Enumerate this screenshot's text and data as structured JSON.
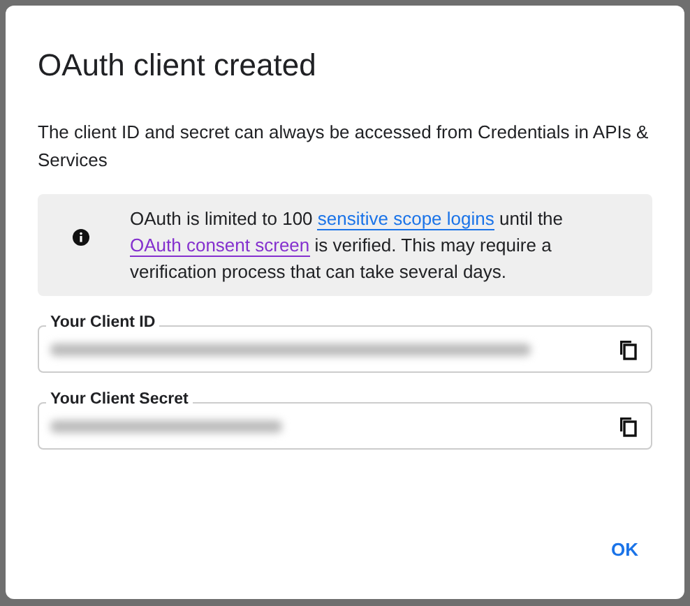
{
  "dialog": {
    "title": "OAuth client created",
    "description": "The client ID and secret can always be accessed from Credentials in APIs & Services",
    "notice": {
      "parts": [
        {
          "kind": "text",
          "text": "OAuth is limited to 100 "
        },
        {
          "kind": "link",
          "text": "sensitive scope logins",
          "visited": false
        },
        {
          "kind": "text",
          "text": " until the "
        },
        {
          "kind": "link",
          "text": "OAuth consent screen",
          "visited": true
        },
        {
          "kind": "text",
          "text": " is verified. This may require a verification process that can take several days."
        }
      ]
    },
    "fields": [
      {
        "label": "Your Client ID"
      },
      {
        "label": "Your Client Secret"
      }
    ],
    "buttons": [
      "OK"
    ]
  }
}
